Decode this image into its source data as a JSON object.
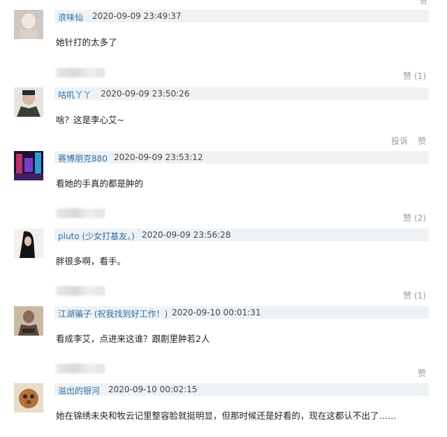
{
  "top_fragment": {
    "left": "",
    "right": "赞"
  },
  "comments": [
    {
      "user": "浪味仙",
      "time": "2020-09-09 23:49:37",
      "text": "她针打的太多了",
      "actions": [
        "赞 (1)"
      ]
    },
    {
      "user": "咕叽丫丫",
      "time": "2020-09-09 23:50:26",
      "text": "啥？这是李心艾~",
      "actions": [
        "投诉",
        "赞"
      ]
    },
    {
      "user": "赛博朋克880",
      "time": "2020-09-09 23:53:12",
      "text": "看她的手真的都是肿的",
      "actions": [
        "赞 (2)"
      ]
    },
    {
      "user": "pluto (少女打基友。)",
      "time": "2020-09-09 23:56:28",
      "text": "胖很多啊，看手。",
      "actions": [
        "赞 (1)"
      ]
    },
    {
      "user": "江湖骗子 (祝我找到好工作！)",
      "time": "2020-09-10 00:01:31",
      "text": "看成李艾，点进来这谁？跟剧里肿若2人",
      "actions": [
        "赞"
      ]
    },
    {
      "user": "溢出的银河",
      "time": "2020-09-10 00:02:15",
      "text": "她在锦绣未央和牧云记里整容脸就挺明显，但那时候还是好看的，现在这都认不出了……",
      "actions": []
    }
  ],
  "colors": {
    "username": "#2f6fa6",
    "meta_bg": "#eef2f5",
    "action_gray": "#999999"
  }
}
